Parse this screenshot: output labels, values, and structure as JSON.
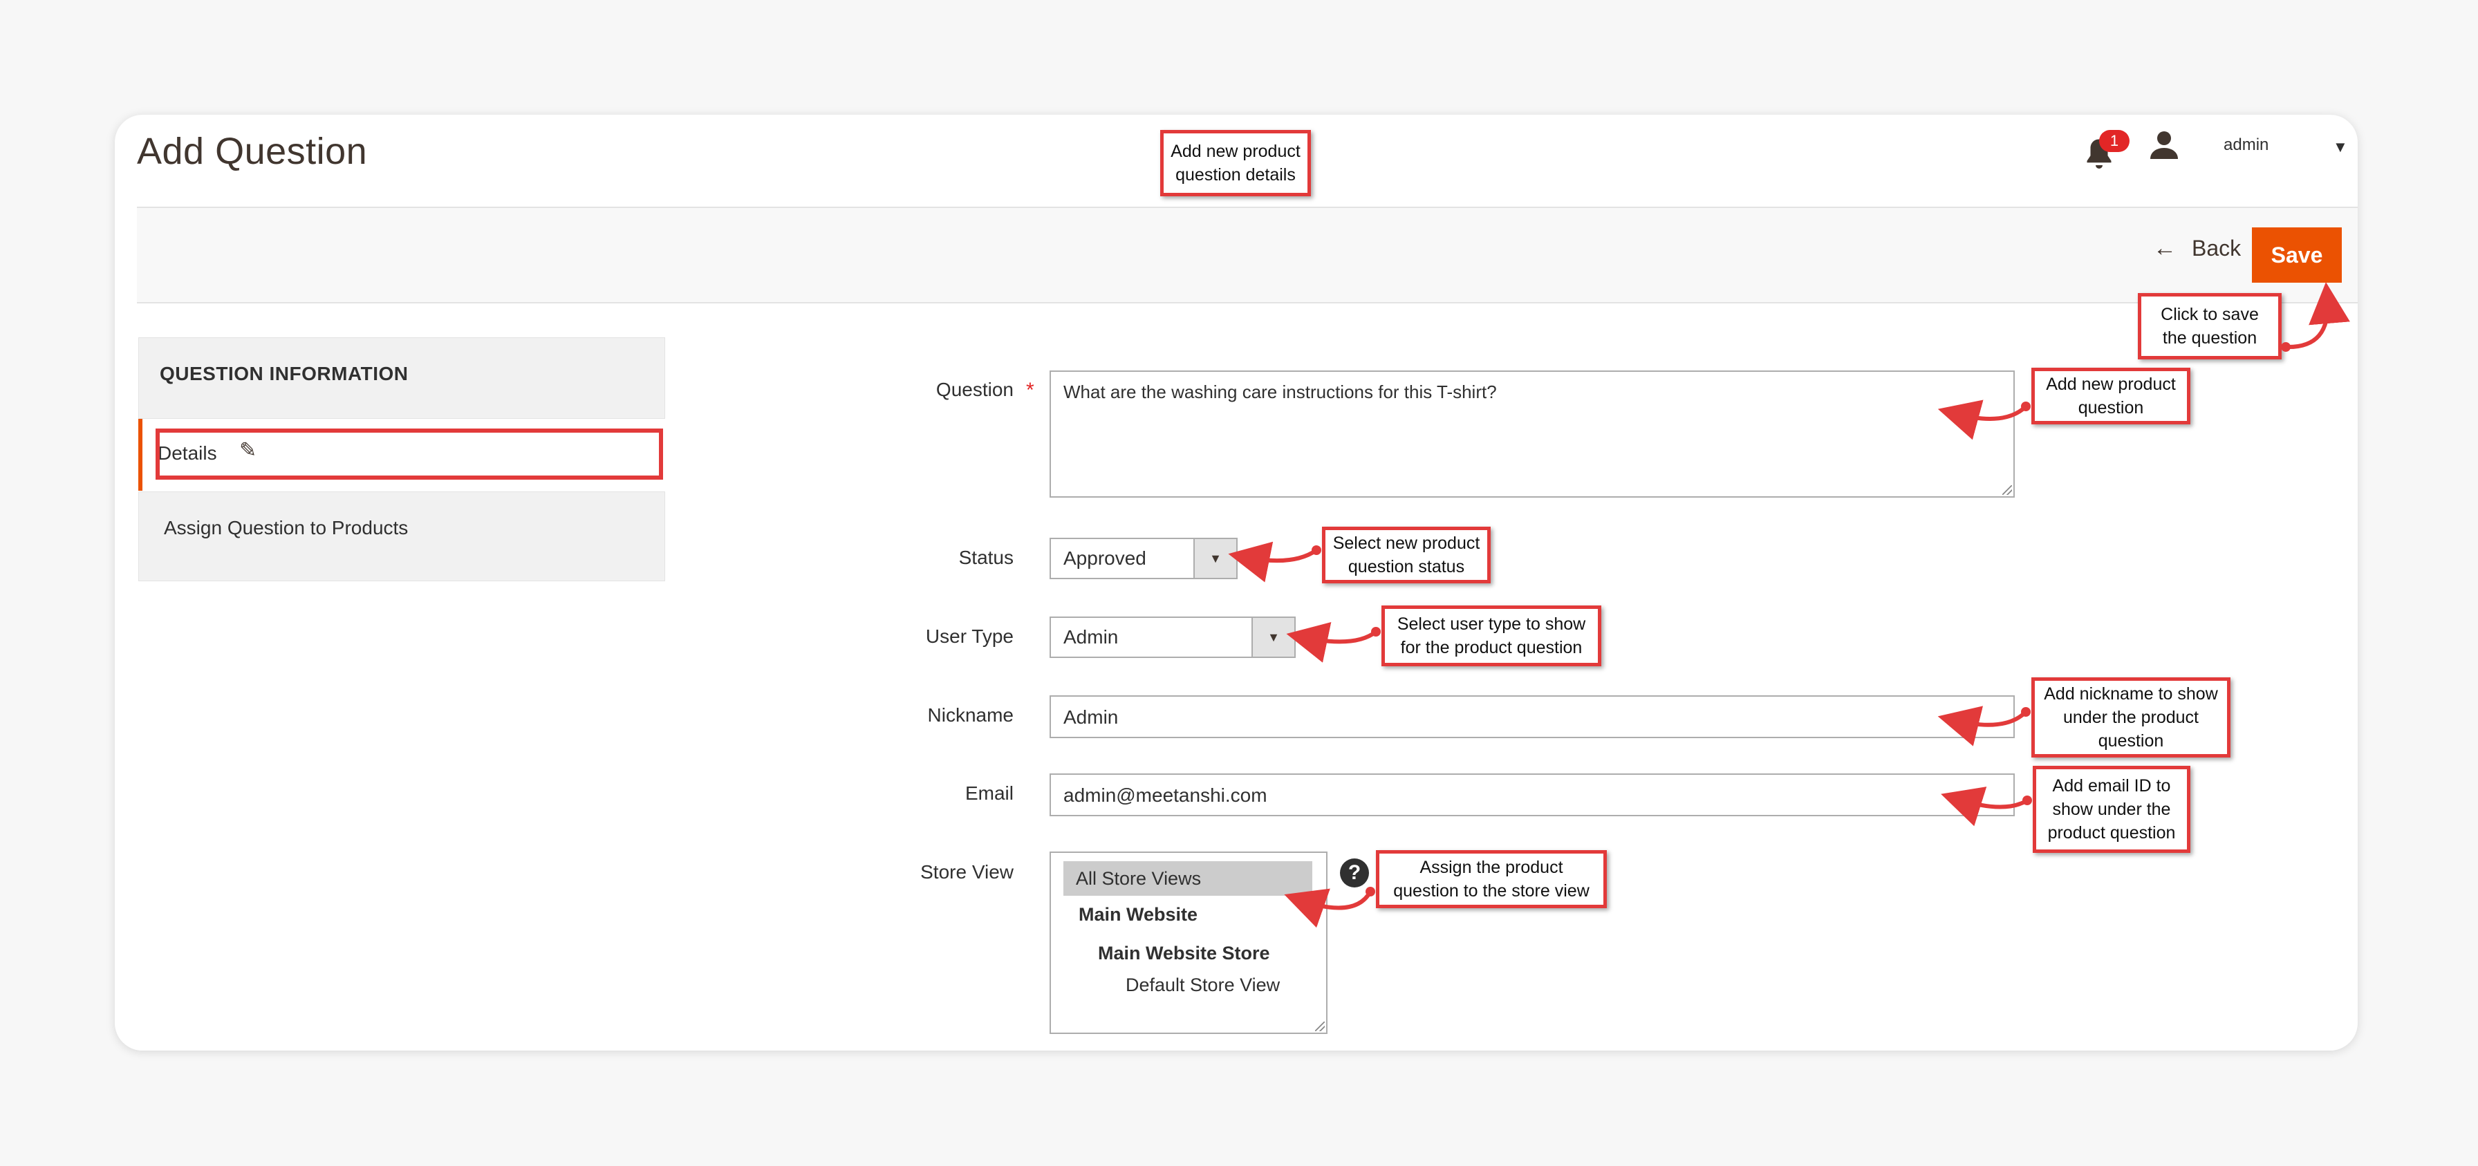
{
  "page": {
    "title": "Add Question"
  },
  "header": {
    "notification_count": "1",
    "user_name": "admin"
  },
  "actions": {
    "back_label": "Back",
    "save_label": "Save"
  },
  "sidebar": {
    "title": "QUESTION INFORMATION",
    "items": [
      {
        "label": "Details",
        "active": true
      },
      {
        "label": "Assign Question to Products",
        "active": false
      }
    ]
  },
  "form": {
    "question": {
      "label": "Question",
      "value": "What are the washing care instructions for this T-shirt?",
      "required": true
    },
    "status": {
      "label": "Status",
      "value": "Approved"
    },
    "user_type": {
      "label": "User Type",
      "value": "Admin"
    },
    "nickname": {
      "label": "Nickname",
      "value": "Admin"
    },
    "email": {
      "label": "Email",
      "value": "admin@meetanshi.com"
    },
    "store_view": {
      "label": "Store View",
      "options": [
        "All Store Views",
        "Main Website",
        "Main Website Store",
        "Default Store View"
      ],
      "selected": "All Store Views"
    }
  },
  "annotations": {
    "title_note": "Add new product question details",
    "save_note": "Click to save the question",
    "question_note": "Add new product question",
    "status_note": "Select new product question status",
    "user_type_note": "Select user type to show for the product question",
    "nickname_note": "Add nickname to show under the product question",
    "email_note": "Add email ID to show under the product question",
    "store_view_note": "Assign the product question to the store view"
  },
  "colors": {
    "accent": "#eb5202",
    "annotation_red": "#e23a3a",
    "badge_red": "#e22626"
  },
  "icons": [
    "bell-icon",
    "user-icon",
    "chevron-down-icon",
    "back-arrow-icon",
    "pencil-icon",
    "help-icon"
  ]
}
